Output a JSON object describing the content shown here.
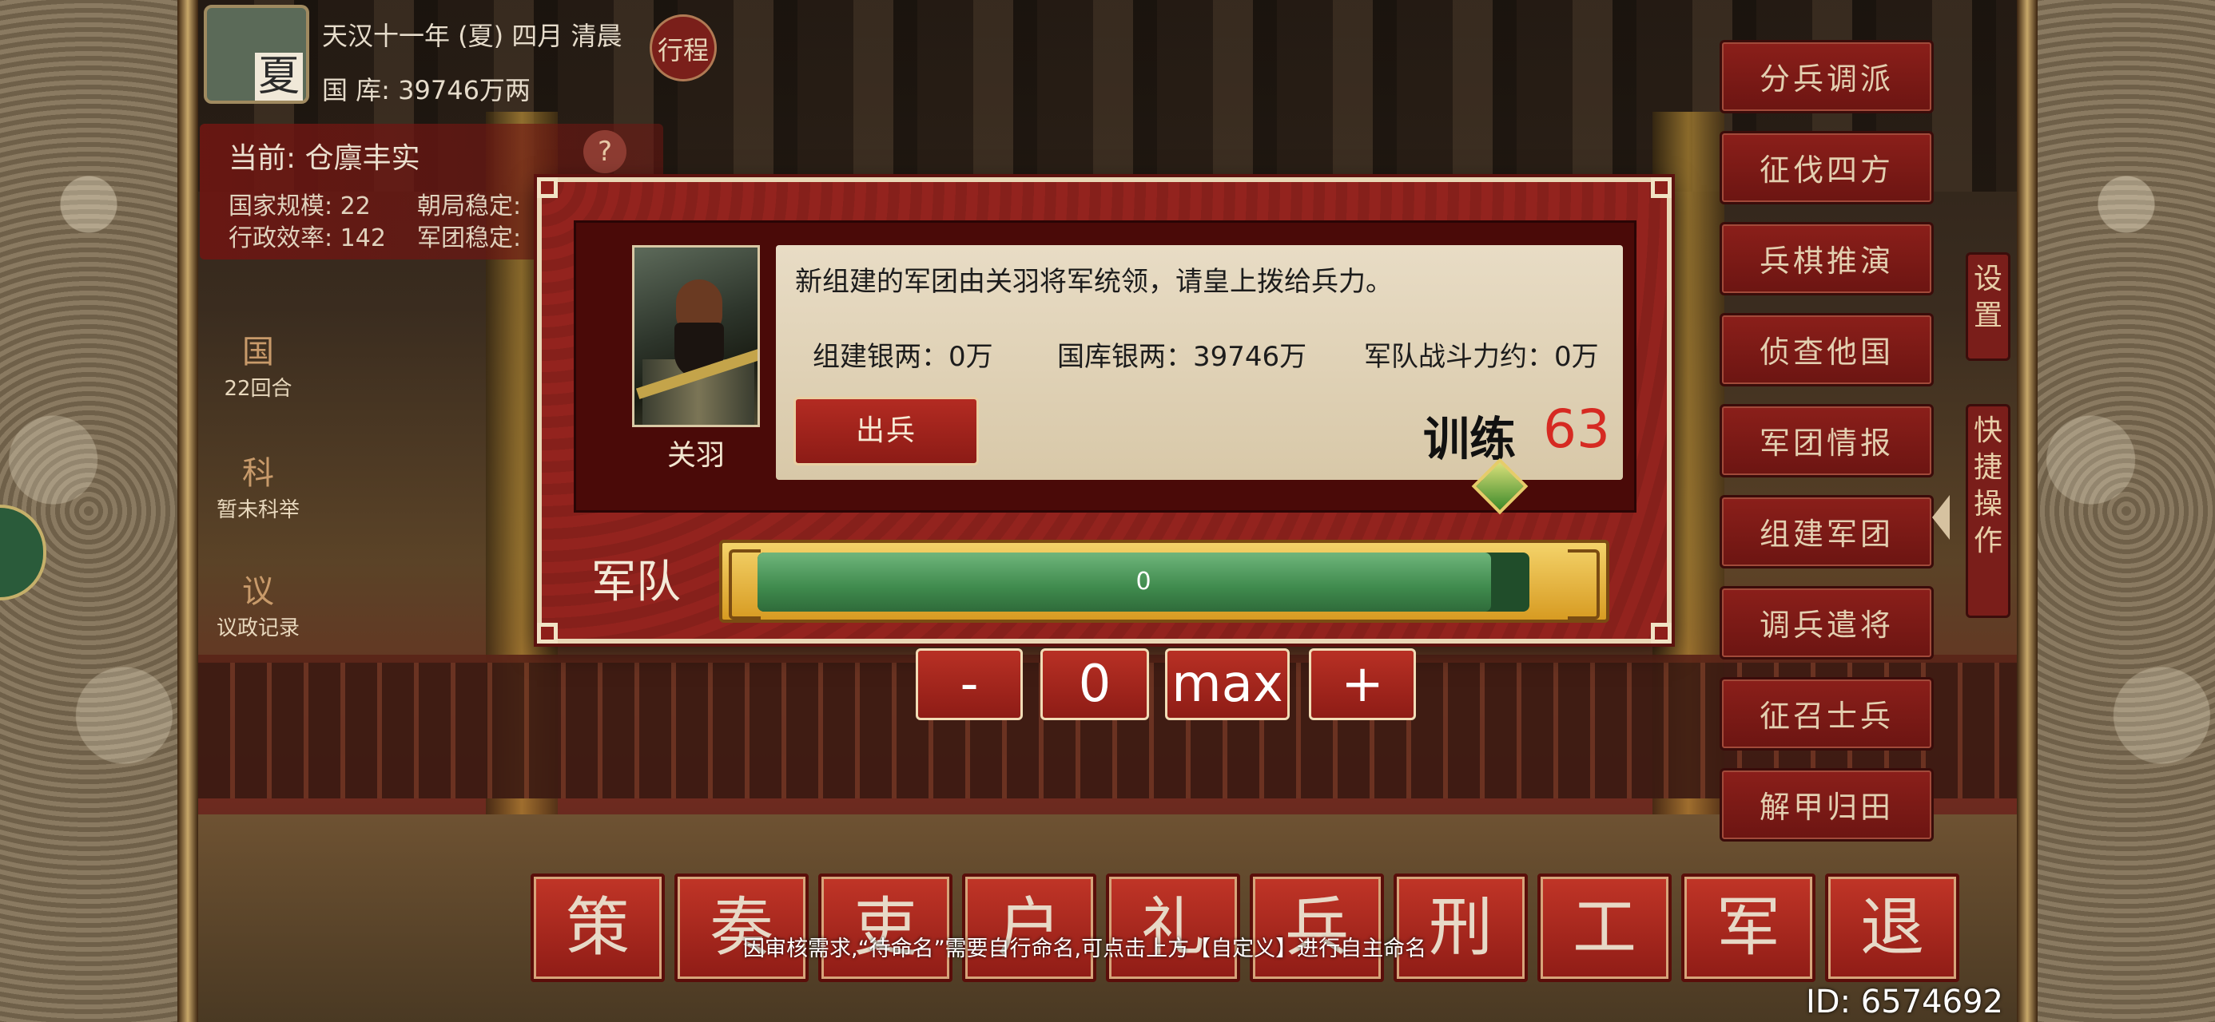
{
  "status": {
    "date": "天汉十一年 (夏) 四月 清晨",
    "treasury": "国 库: 39746万两",
    "season": "夏",
    "trip_button": "行程"
  },
  "state": {
    "title": "当前: 仓廪丰实",
    "help": "?",
    "stats": [
      "国家规模: 22",
      "朝局稳定:",
      "行政效率: 142",
      "军团稳定:"
    ]
  },
  "left_menu": [
    {
      "icon": "国",
      "label": "22回合"
    },
    {
      "icon": "科",
      "label": "暂未科举"
    },
    {
      "icon": "议",
      "label": "议政记录"
    }
  ],
  "right_menu": [
    "分兵调派",
    "征伐四方",
    "兵棋推演",
    "侦查他国",
    "军团情报",
    "组建军团",
    "调兵遣将",
    "征召士兵",
    "解甲归田"
  ],
  "side_tabs": {
    "settings": "设\n置",
    "quick": "快\n捷\n操\n作"
  },
  "dialog": {
    "general_name": "关羽",
    "message": "新组建的军团由关羽将军统领，请皇上拨给兵力。",
    "build_silver": "组建银两：0万",
    "treasury_silver": "国库银两：39746万",
    "army_power": "军队战斗力约：0万",
    "deploy_button": "出兵",
    "training_label": "训练",
    "training_value": "63",
    "army_label": "军队",
    "army_value": "0",
    "army_fill_fraction": 0.95
  },
  "controls": {
    "minus": "-",
    "value": "0",
    "max": "max",
    "plus": "+"
  },
  "bottom_nav": [
    "策",
    "奏",
    "吏",
    "户",
    "礼",
    "兵",
    "刑",
    "工",
    "军",
    "退"
  ],
  "notice": "因审核需求,“待命名”需要自行命名,可点击上方【自定义】进行自主命名",
  "user_id": "ID: 6574692"
}
